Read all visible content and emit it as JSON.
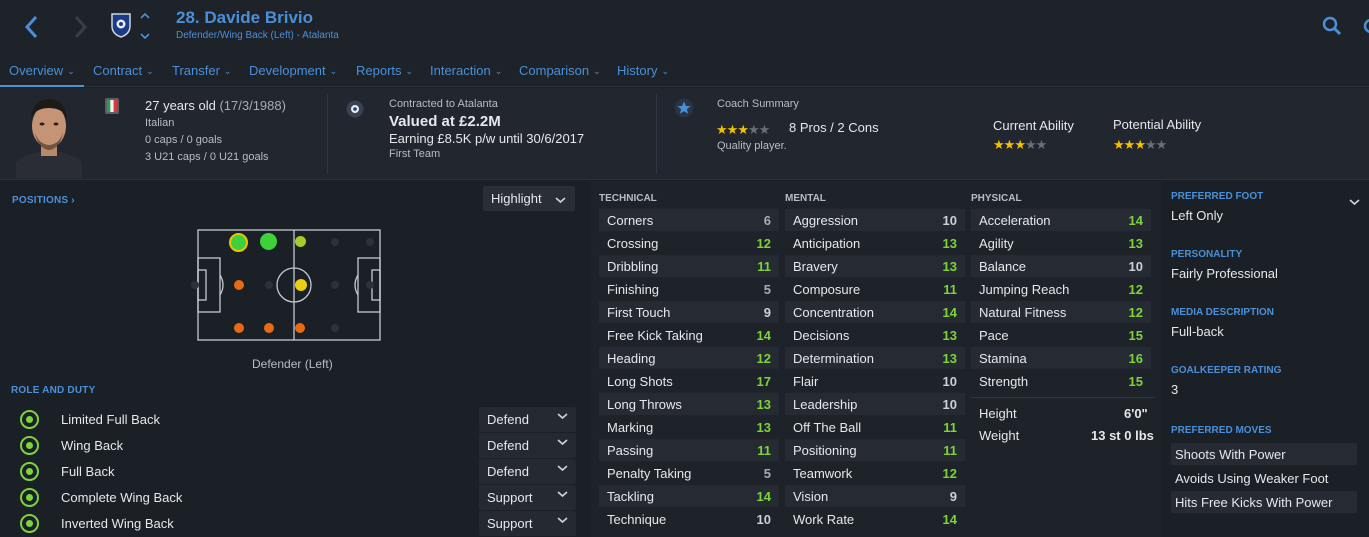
{
  "header": {
    "player_title": "28. Davide Brivio",
    "player_subtitle": "Defender/Wing Back (Left) - Atalanta"
  },
  "nav": {
    "tabs": [
      {
        "label": "Overview"
      },
      {
        "label": "Contract"
      },
      {
        "label": "Transfer"
      },
      {
        "label": "Development"
      },
      {
        "label": "Reports"
      },
      {
        "label": "Interaction"
      },
      {
        "label": "Comparison"
      },
      {
        "label": "History"
      }
    ]
  },
  "info": {
    "age": "27 years old",
    "dob": "(17/3/1988)",
    "nationality": "Italian",
    "caps": "0 caps / 0 goals",
    "u21_caps": "3 U21 caps / 0 U21 goals",
    "contract_label": "Contracted to Atalanta",
    "value": "Valued at £2.2M",
    "earning": "Earning £8.5K p/w until 30/6/2017",
    "squad_status": "First Team",
    "coach_label": "Coach Summary",
    "coach_stars": 3,
    "pros_cons": "8 Pros / 2 Cons",
    "coach_comment": "Quality player.",
    "current_ability_label": "Current Ability",
    "current_ability_stars": 3,
    "potential_ability_label": "Potential Ability",
    "potential_ability_stars": 3
  },
  "positions": {
    "title": "POSITIONS",
    "highlight_label": "Highlight",
    "caption": "Defender (Left)"
  },
  "roles": {
    "title": "ROLE AND DUTY",
    "items": [
      {
        "name": "Limited Full Back",
        "duty": "Defend"
      },
      {
        "name": "Wing Back",
        "duty": "Defend"
      },
      {
        "name": "Full Back",
        "duty": "Defend"
      },
      {
        "name": "Complete Wing Back",
        "duty": "Support"
      },
      {
        "name": "Inverted Wing Back",
        "duty": "Support"
      }
    ]
  },
  "attributes": {
    "technical_title": "TECHNICAL",
    "mental_title": "MENTAL",
    "physical_title": "PHYSICAL",
    "technical": [
      {
        "name": "Corners",
        "value": "6"
      },
      {
        "name": "Crossing",
        "value": "12"
      },
      {
        "name": "Dribbling",
        "value": "11"
      },
      {
        "name": "Finishing",
        "value": "5"
      },
      {
        "name": "First Touch",
        "value": "9"
      },
      {
        "name": "Free Kick Taking",
        "value": "14"
      },
      {
        "name": "Heading",
        "value": "12"
      },
      {
        "name": "Long Shots",
        "value": "17"
      },
      {
        "name": "Long Throws",
        "value": "13"
      },
      {
        "name": "Marking",
        "value": "13"
      },
      {
        "name": "Passing",
        "value": "11"
      },
      {
        "name": "Penalty Taking",
        "value": "5"
      },
      {
        "name": "Tackling",
        "value": "14"
      },
      {
        "name": "Technique",
        "value": "10"
      }
    ],
    "mental": [
      {
        "name": "Aggression",
        "value": "10"
      },
      {
        "name": "Anticipation",
        "value": "13"
      },
      {
        "name": "Bravery",
        "value": "13"
      },
      {
        "name": "Composure",
        "value": "11"
      },
      {
        "name": "Concentration",
        "value": "14"
      },
      {
        "name": "Decisions",
        "value": "13"
      },
      {
        "name": "Determination",
        "value": "13"
      },
      {
        "name": "Flair",
        "value": "10"
      },
      {
        "name": "Leadership",
        "value": "10"
      },
      {
        "name": "Off The Ball",
        "value": "11"
      },
      {
        "name": "Positioning",
        "value": "11"
      },
      {
        "name": "Teamwork",
        "value": "12"
      },
      {
        "name": "Vision",
        "value": "9"
      },
      {
        "name": "Work Rate",
        "value": "14"
      }
    ],
    "physical": [
      {
        "name": "Acceleration",
        "value": "14"
      },
      {
        "name": "Agility",
        "value": "13"
      },
      {
        "name": "Balance",
        "value": "10"
      },
      {
        "name": "Jumping Reach",
        "value": "12"
      },
      {
        "name": "Natural Fitness",
        "value": "12"
      },
      {
        "name": "Pace",
        "value": "15"
      },
      {
        "name": "Stamina",
        "value": "16"
      },
      {
        "name": "Strength",
        "value": "15"
      }
    ],
    "height_label": "Height",
    "height": "6'0\"",
    "weight_label": "Weight",
    "weight": "13 st 0 lbs"
  },
  "side": {
    "preferred_foot_label": "PREFERRED FOOT",
    "preferred_foot": "Left Only",
    "personality_label": "PERSONALITY",
    "personality": "Fairly Professional",
    "media_label": "MEDIA DESCRIPTION",
    "media": "Full-back",
    "gk_label": "GOALKEEPER RATING",
    "gk": "3",
    "moves_label": "PREFERRED MOVES",
    "moves": [
      "Shoots With Power",
      "Avoids Using Weaker Foot",
      "Hits Free Kicks With Power"
    ]
  },
  "colors": {
    "accent": "#4a90d9",
    "good": "#7cd43a",
    "star": "#f2c200"
  }
}
